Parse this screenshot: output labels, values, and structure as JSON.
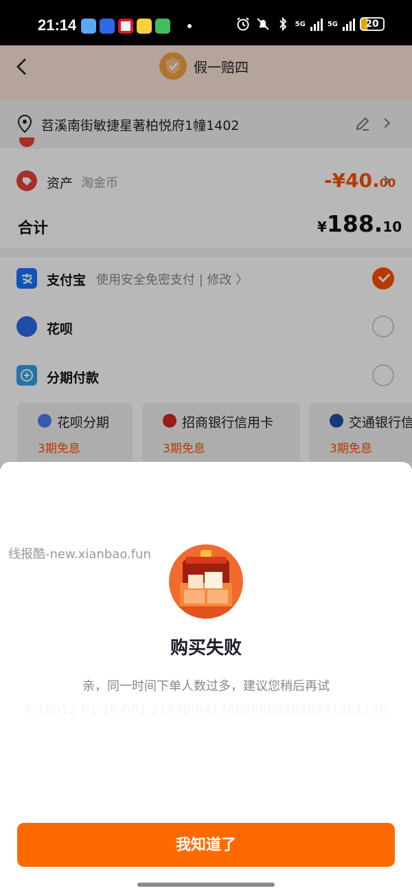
{
  "status_bar": {
    "time": "21:14",
    "battery": "20",
    "signal_labels": [
      "5G",
      "5G"
    ],
    "app_icons": [
      "weather-icon",
      "message-icon",
      "weibo-icon",
      "jiemao-icon",
      "chat-icon"
    ]
  },
  "header": {
    "title": "假一赔四"
  },
  "address": {
    "text": "苕溪南街敏捷星著柏悦府1幢1402"
  },
  "asset_row": {
    "label": "资产",
    "sub": "淘金币",
    "value_main": "-¥40.",
    "value_decimal": "00"
  },
  "total_row": {
    "label": "合计",
    "yen": "¥",
    "value_main": "188.",
    "value_decimal": "10"
  },
  "payment": {
    "alipay_label": "支付宝",
    "alipay_sub": "使用安全免密支付 | 修改 〉",
    "huabei_label": "花呗",
    "installment_label": "分期付款",
    "plans": [
      {
        "name": "花呗分期",
        "sub": "3期免息"
      },
      {
        "name": "招商银行信用卡",
        "sub": "3期免息"
      },
      {
        "name": "交通银行信",
        "sub": "3期免息"
      }
    ]
  },
  "dialog": {
    "watermark": "线报酷-new.xianbao.fun",
    "title": "购买失败",
    "message": "亲，同一时间下单人数过多，建议您稍后再试",
    "code": "F-10012-01-16-001 2147bf6417609860850385912e117b",
    "confirm_label": "我知道了"
  },
  "colors": {
    "accent": "#ff6a00",
    "price": "#ff5000",
    "header_bg": "#fbe3d8"
  }
}
